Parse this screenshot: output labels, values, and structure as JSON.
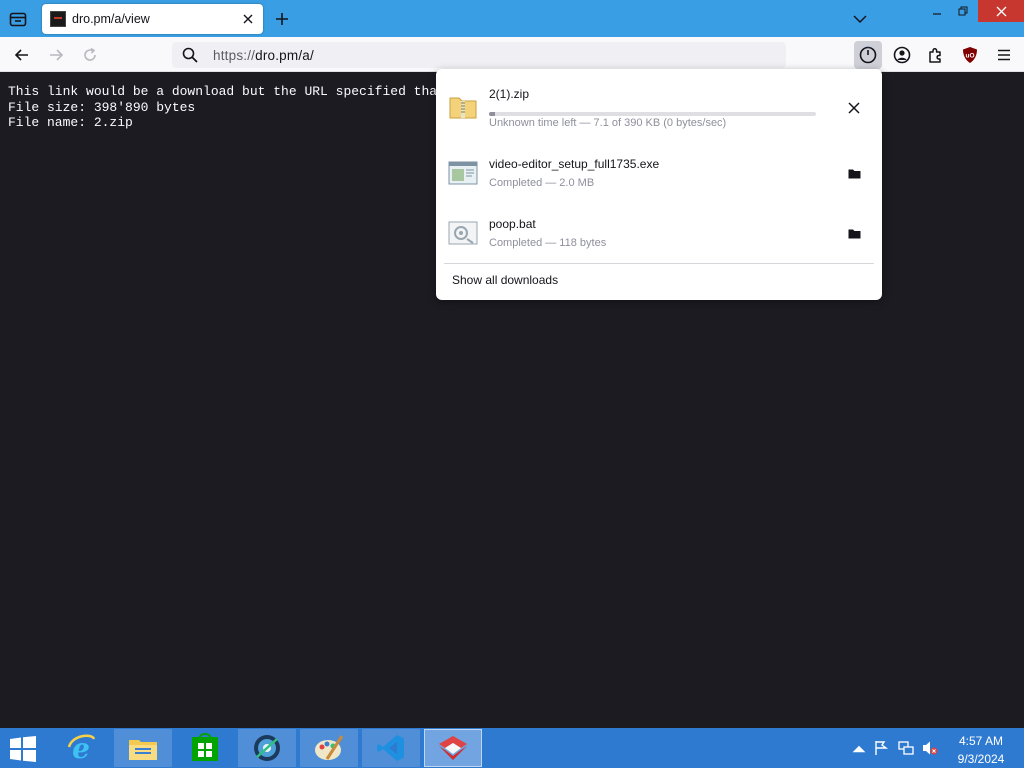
{
  "browser": {
    "tab": {
      "title": "dro.pm/a/view"
    },
    "url": {
      "scheme": "https://",
      "host_path": "dro.pm/a/"
    }
  },
  "page": {
    "lines": [
      "This link would be a download but the URL specified that you",
      "File size: 398'890 bytes",
      "File name: 2.zip"
    ]
  },
  "downloads": {
    "items": [
      {
        "name": "2(1).zip",
        "status": "Unknown time left — 7.1 of 390 KB (0 bytes/sec)",
        "progress": 0.018,
        "icon": "zip-folder-icon",
        "action": "cancel-icon"
      },
      {
        "name": "video-editor_setup_full1735.exe",
        "status": "Completed — 2.0 MB",
        "icon": "exe-file-icon",
        "action": "folder-icon"
      },
      {
        "name": "poop.bat",
        "status": "Completed — 118 bytes",
        "icon": "bat-file-icon",
        "action": "folder-icon"
      }
    ],
    "show_all_label": "Show all downloads"
  },
  "taskbar": {
    "apps": [
      "internet-explorer-icon",
      "file-explorer-icon",
      "store-icon",
      "media-icon",
      "paint-icon",
      "vscode-icon",
      "firefox-icon"
    ],
    "clock": {
      "time": "4:57 AM",
      "date": "9/3/2024"
    }
  },
  "colors": {
    "tabstrip": "#3a9ee4",
    "page_bg": "#1c1b22",
    "taskbar": "#2f7ad1",
    "close": "#c7372f",
    "ublock": "#800000"
  }
}
